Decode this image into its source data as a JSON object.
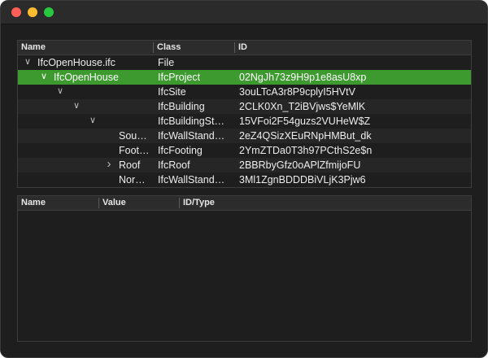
{
  "window": {
    "controls": [
      "close",
      "minimize",
      "zoom"
    ]
  },
  "tree": {
    "columns": [
      "Name",
      "Class",
      "ID"
    ],
    "rows": [
      {
        "name": "IfcOpenHouse.ifc",
        "class": "File",
        "id": "",
        "depth": 0,
        "expander": "expanded"
      },
      {
        "name": "IfcOpenHouse",
        "class": "IfcProject",
        "id": "02NgJh73z9H9p1e8asU8xp",
        "depth": 1,
        "expander": "expanded",
        "selected": true
      },
      {
        "name": "",
        "class": "IfcSite",
        "id": "3ouLTcA3r8P9cplyI5HVtV",
        "depth": 2,
        "expander": "expanded"
      },
      {
        "name": "",
        "class": "IfcBuilding",
        "id": "2CLK0Xn_T2iBVjws$YeMlK",
        "depth": 3,
        "expander": "expanded"
      },
      {
        "name": "",
        "class": "IfcBuildingSt…",
        "id": "15VFoi2F54guzs2VUHeW$Z",
        "depth": 4,
        "expander": "expanded"
      },
      {
        "name": "Sou…",
        "class": "IfcWallStand…",
        "id": "2eZ4QSizXEuRNpHMBut_dk",
        "depth": 5,
        "expander": "none"
      },
      {
        "name": "Foot…",
        "class": "IfcFooting",
        "id": "2YmZTDa0T3h97PCthS2e$n",
        "depth": 5,
        "expander": "none"
      },
      {
        "name": "Roof",
        "class": "IfcRoof",
        "id": "2BBRbyGfz0oAPlZfmijoFU",
        "depth": 5,
        "expander": "collapsed"
      },
      {
        "name": "Nor…",
        "class": "IfcWallStand…",
        "id": "3Ml1ZgnBDDDBiVLjK3Pjw6",
        "depth": 5,
        "expander": "none"
      }
    ]
  },
  "properties": {
    "columns": [
      "Name",
      "Value",
      "ID/Type"
    ]
  },
  "colors": {
    "selection": "#3c9a2f",
    "background": "#1e1e1e"
  }
}
